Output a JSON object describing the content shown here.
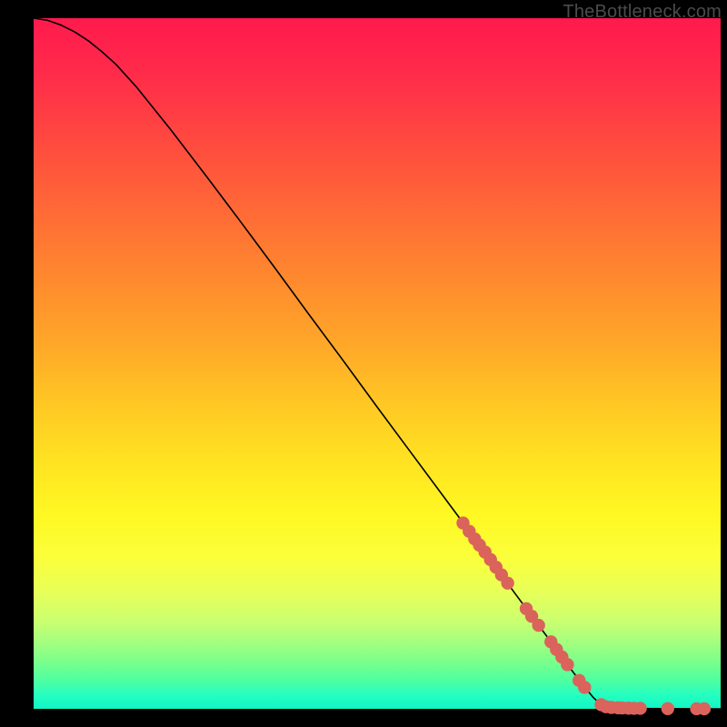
{
  "watermark": "TheBottleneck.com",
  "chart_data": {
    "type": "line",
    "title": "",
    "xlabel": "",
    "ylabel": "",
    "xlim": [
      0,
      100
    ],
    "ylim": [
      0,
      100
    ],
    "grid": false,
    "legend": false,
    "series": [
      {
        "name": "bottleneck-curve",
        "kind": "line",
        "points": [
          {
            "x": 0,
            "y": 100
          },
          {
            "x": 2,
            "y": 99.7
          },
          {
            "x": 4,
            "y": 99.0
          },
          {
            "x": 6,
            "y": 98.0
          },
          {
            "x": 8,
            "y": 96.7
          },
          {
            "x": 10,
            "y": 95.1
          },
          {
            "x": 12,
            "y": 93.3
          },
          {
            "x": 15,
            "y": 90.0
          },
          {
            "x": 20,
            "y": 83.8
          },
          {
            "x": 25,
            "y": 77.3
          },
          {
            "x": 30,
            "y": 70.7
          },
          {
            "x": 35,
            "y": 64.0
          },
          {
            "x": 40,
            "y": 57.2
          },
          {
            "x": 45,
            "y": 50.5
          },
          {
            "x": 50,
            "y": 43.7
          },
          {
            "x": 55,
            "y": 37.0
          },
          {
            "x": 60,
            "y": 30.3
          },
          {
            "x": 65,
            "y": 23.6
          },
          {
            "x": 70,
            "y": 16.8
          },
          {
            "x": 75,
            "y": 10.1
          },
          {
            "x": 78,
            "y": 6.0
          },
          {
            "x": 80,
            "y": 3.4
          },
          {
            "x": 81.5,
            "y": 1.6
          },
          {
            "x": 82.5,
            "y": 0.7
          },
          {
            "x": 83.5,
            "y": 0.28
          },
          {
            "x": 85,
            "y": 0.12
          },
          {
            "x": 88,
            "y": 0.05
          },
          {
            "x": 92,
            "y": 0.02
          },
          {
            "x": 96,
            "y": 0.01
          },
          {
            "x": 100,
            "y": 0.0
          }
        ]
      },
      {
        "name": "highlight-markers",
        "kind": "scatter",
        "points": [
          {
            "x": 62.5,
            "y": 26.9
          },
          {
            "x": 63.4,
            "y": 25.7
          },
          {
            "x": 64.2,
            "y": 24.6
          },
          {
            "x": 64.9,
            "y": 23.7
          },
          {
            "x": 65.7,
            "y": 22.7
          },
          {
            "x": 66.5,
            "y": 21.6
          },
          {
            "x": 67.3,
            "y": 20.5
          },
          {
            "x": 68.1,
            "y": 19.4
          },
          {
            "x": 69.0,
            "y": 18.2
          },
          {
            "x": 71.7,
            "y": 14.5
          },
          {
            "x": 72.5,
            "y": 13.4
          },
          {
            "x": 73.5,
            "y": 12.1
          },
          {
            "x": 75.3,
            "y": 9.7
          },
          {
            "x": 76.1,
            "y": 8.6
          },
          {
            "x": 76.9,
            "y": 7.5
          },
          {
            "x": 77.7,
            "y": 6.4
          },
          {
            "x": 79.4,
            "y": 4.1
          },
          {
            "x": 80.2,
            "y": 3.1
          },
          {
            "x": 82.6,
            "y": 0.6
          },
          {
            "x": 83.3,
            "y": 0.3
          },
          {
            "x": 84.1,
            "y": 0.2
          },
          {
            "x": 85.1,
            "y": 0.15
          },
          {
            "x": 85.7,
            "y": 0.12
          },
          {
            "x": 86.6,
            "y": 0.1
          },
          {
            "x": 87.4,
            "y": 0.08
          },
          {
            "x": 88.3,
            "y": 0.07
          },
          {
            "x": 92.3,
            "y": 0.03
          },
          {
            "x": 96.5,
            "y": 0.01
          },
          {
            "x": 97.6,
            "y": 0.005
          }
        ]
      }
    ],
    "colors": {
      "curve": "#000000",
      "marker": "#da635b",
      "gradient_top": "#ff1a4d",
      "gradient_mid": "#ffe222",
      "gradient_bottom": "#12f5c5"
    }
  }
}
